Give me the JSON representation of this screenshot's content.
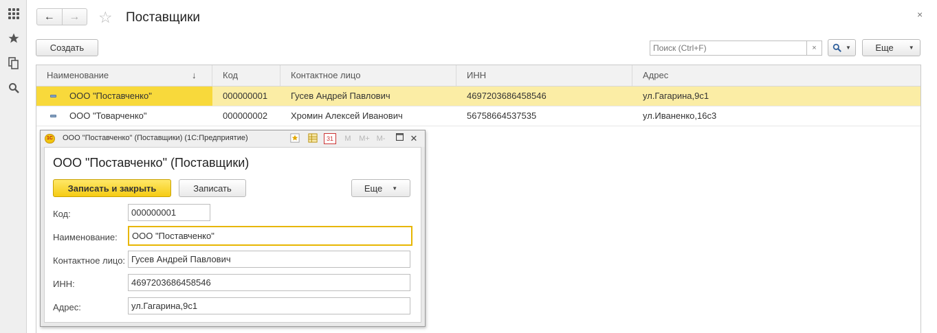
{
  "header": {
    "title": "Поставщики",
    "back_icon": "←",
    "forward_icon": "→",
    "close_icon": "×"
  },
  "toolbar": {
    "create_label": "Создать",
    "search_placeholder": "Поиск (Ctrl+F)",
    "search_clear": "×",
    "more_label": "Еще"
  },
  "table": {
    "columns": [
      "Наименование",
      "Код",
      "Контактное лицо",
      "ИНН",
      "Адрес"
    ],
    "sort_indicator": "↓",
    "rows": [
      {
        "name": "ООО \"Поставченко\"",
        "code": "000000001",
        "contact": "Гусев Андрей Павлович",
        "inn": "4697203686458546",
        "address": "ул.Гагарина,9с1",
        "selected": true
      },
      {
        "name": "ООО \"Товарченко\"",
        "code": "000000002",
        "contact": "Хромин Алексей Иванович",
        "inn": "56758664537535",
        "address": "ул.Иваненко,16с3",
        "selected": false
      }
    ]
  },
  "dialog": {
    "titlebar": "ООО \"Поставченко\" (Поставщики)  (1С:Предприятие)",
    "logo_text": "1С",
    "heading": "ООО \"Поставченко\" (Поставщики)",
    "save_close_label": "Записать и закрыть",
    "save_label": "Записать",
    "more_label": "Еще",
    "tb_m": "M",
    "tb_mplus": "M+",
    "tb_mminus": "M-",
    "tb_calendar": "31",
    "tb_close": "✕",
    "fields": {
      "code_label": "Код:",
      "code_value": "000000001",
      "name_label": "Наименование:",
      "name_value": "ООО \"Поставченко\"",
      "contact_label": "Контактное лицо:",
      "contact_value": "Гусев Андрей Павлович",
      "inn_label": "ИНН:",
      "inn_value": "4697203686458546",
      "address_label": "Адрес:",
      "address_value": "ул.Гагарина,9с1"
    }
  },
  "colors": {
    "selected_row": "#fbeda5",
    "selected_cell": "#f8d93b",
    "primary_button": "#f5cb14",
    "focus_border": "#e7b600"
  }
}
